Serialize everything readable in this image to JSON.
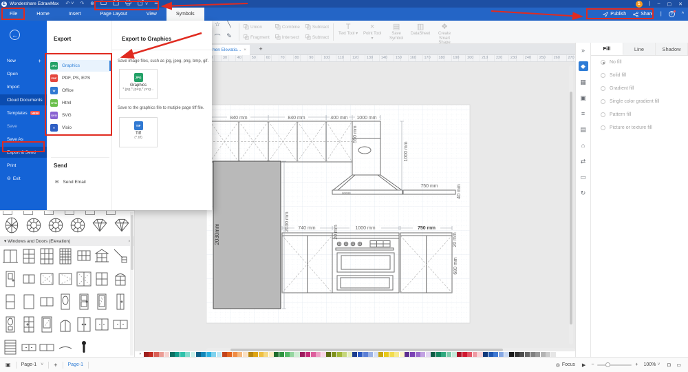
{
  "titlebar": {
    "app_title": "Wondershare EdrawMax",
    "notification_badge": "1",
    "window_buttons": {
      "minimize": "–",
      "maximize": "▢",
      "close": "✕"
    },
    "qat_icons": [
      "undo-icon",
      "redo-icon",
      "new-page-icon",
      "open-icon",
      "save-icon",
      "print-icon",
      "export-icon",
      "customize-qat-icon"
    ]
  },
  "menubar": {
    "tabs": [
      "File",
      "Home",
      "Insert",
      "Page Layout",
      "View",
      "Symbols"
    ],
    "active_tab": "Symbols",
    "publish_label": "Publish",
    "share_label": "Share",
    "collapse_icon": "^",
    "help_icon": "?"
  },
  "ribbon": {
    "shape_tools": [
      {
        "name": "star-shape-icon",
        "glyph": "☆"
      },
      {
        "name": "line-tool-icon",
        "glyph": "╲"
      },
      {
        "name": "arc-tool-icon",
        "glyph": "⌒"
      },
      {
        "name": "pen-tool-icon",
        "glyph": "✎"
      }
    ],
    "bool_ops": [
      "Union",
      "Combine",
      "Subtract",
      "Fragment",
      "Intersect",
      "Subtract"
    ],
    "tools": [
      {
        "glyph": "T",
        "label": "Text Tool ▾"
      },
      {
        "glyph": "×",
        "label": "Point Tool ▾"
      },
      {
        "glyph": "▤",
        "label": "Save Symbol"
      },
      {
        "glyph": "▥",
        "label": "DataSheet"
      },
      {
        "glyph": "❖",
        "label": "Create Smart Shape"
      }
    ]
  },
  "doc_tabs": {
    "active_label": "hen Elevatio...",
    "close": "×",
    "add": "+"
  },
  "ruler": {
    "start": 20,
    "end": 270,
    "step": 10
  },
  "file_menu": {
    "items": [
      {
        "label": "New",
        "suffix": "+"
      },
      {
        "label": "Open"
      },
      {
        "label": "Import"
      },
      {
        "label": "Cloud Documents",
        "highlighted": true
      },
      {
        "label": "Templates",
        "badge": "NEW"
      },
      {
        "label": "Save",
        "dimmed": true
      },
      {
        "label": "Save As"
      },
      {
        "label": "Export & Send",
        "highlighted": true
      },
      {
        "label": "Print"
      },
      {
        "label": "Exit",
        "prefix": "⊖"
      }
    ]
  },
  "export_panel": {
    "heading": "Export",
    "formats": [
      {
        "label": "Graphics",
        "icon_text": "JPG",
        "icon_color": "#23a167",
        "selected": true
      },
      {
        "label": "PDF, PS, EPS",
        "icon_text": "PDF",
        "icon_color": "#e5473e"
      },
      {
        "label": "Office",
        "icon_text": "W",
        "icon_color": "#3079d2"
      },
      {
        "label": "Html",
        "icon_text": "HTM",
        "icon_color": "#6abf4b"
      },
      {
        "label": "SVG",
        "icon_text": "SVG",
        "icon_color": "#8a63d2"
      },
      {
        "label": "Visio",
        "icon_text": "V",
        "icon_color": "#2f5fc4"
      }
    ],
    "send_heading": "Send",
    "send_email_label": "Send Email",
    "right": {
      "heading": "Export to Graphics",
      "desc1": "Save image files, such as jpg, jpeg, png, bmp, gif.",
      "card1": {
        "title": "Graphics",
        "sub": "*.jpg,*.jpeg,*.png...",
        "icon_text": "JPG",
        "icon_color": "#23a167"
      },
      "desc2": "Save to the graphics file to mutiple page tiff file.",
      "card2": {
        "title": "Tiff",
        "sub": "(*.tif)",
        "icon_text": "TIF",
        "icon_color": "#3079d2"
      }
    }
  },
  "drawing": {
    "dims": {
      "d840a": "840 mm",
      "d840b": "840 mm",
      "d400": "400 mm",
      "d1000hood": "1000 mm",
      "d550": "550 mm",
      "d1000r": "1000 mm",
      "d750shelf": "750 mm",
      "d40": "40 mm",
      "label2030": "2030mm",
      "d2030": "2030 mm",
      "d740": "740 mm",
      "d1000stove": "1000 mm",
      "d750base": "750 mm",
      "d20l": "20 mm",
      "d20r": "20 mm",
      "d680": "680 mm"
    }
  },
  "right_strip": {
    "icons": [
      {
        "name": "more-panels-icon",
        "glyph": "»",
        "active": false
      },
      {
        "name": "fill-tool-icon",
        "glyph": "◆",
        "active": true
      },
      {
        "name": "symbol-library-icon",
        "glyph": "▦",
        "active": false
      },
      {
        "name": "picture-icon",
        "glyph": "▣",
        "active": false
      },
      {
        "name": "layers-icon",
        "glyph": "≡",
        "active": false
      },
      {
        "name": "notes-icon",
        "glyph": "▤",
        "active": false
      },
      {
        "name": "floorplan-icon",
        "glyph": "⌂",
        "active": false
      },
      {
        "name": "swap-icon",
        "glyph": "⇄",
        "active": false
      },
      {
        "name": "presentation-icon",
        "glyph": "▭",
        "active": false
      },
      {
        "name": "history-icon",
        "glyph": "↻",
        "active": false
      }
    ]
  },
  "right_panel": {
    "tabs": [
      "Fill",
      "Line",
      "Shadow"
    ],
    "active_tab": "Fill",
    "fill_options": [
      "No fill",
      "Solid fill",
      "Gradient fill",
      "Single color gradient fill",
      "Pattern fill",
      "Picture or texture fill"
    ],
    "selected_option": "No fill"
  },
  "library": {
    "header": "Windows and Doors (Elevation)",
    "close": "×",
    "collapse_icon": "▾",
    "gems": [
      "gemoval",
      "gemround",
      "gemround",
      "gemround",
      "diamond",
      "diamond"
    ],
    "symbols": [
      "w2",
      "g6",
      "g9",
      "gd",
      "g23",
      "ped",
      "lamp",
      "door1",
      "w2s",
      "wx",
      "wv",
      "wxl",
      "w4",
      "archg",
      "w2v",
      "blank",
      "w2h",
      "ovald",
      "paneld",
      "mirrord",
      "slimd",
      "ovali",
      "panel2",
      "glassd",
      "archd",
      "dbl",
      "dblcab",
      "widecab",
      "shutter",
      "widelow",
      "widelow2",
      "awning",
      "handle"
    ]
  },
  "palette": {
    "colors": [
      "#9c1f1d",
      "#c22a20",
      "#da6056",
      "#eb9d96",
      "#f6d2cf",
      "#0e6f62",
      "#139c8a",
      "#2fc2ab",
      "#82dccd",
      "#c8f0e9",
      "#0c6086",
      "#1287ba",
      "#2cb1e0",
      "#80d2ee",
      "#c0e8f6",
      "#c2441c",
      "#e2641f",
      "#f08c44",
      "#f6b97f",
      "#fbe0c2",
      "#b8860f",
      "#dda414",
      "#efc043",
      "#f6d982",
      "#fbeec4",
      "#1e6b2d",
      "#2e9440",
      "#55b968",
      "#95d6a0",
      "#d0ecd4",
      "#9c1c5e",
      "#c42a77",
      "#dd5f9d",
      "#eea0c5",
      "#f8d5e6",
      "#5d6b14",
      "#7e911c",
      "#a3b83a",
      "#c5d67b",
      "#e5eebd",
      "#1b3d8f",
      "#2a58c0",
      "#5b7fd6",
      "#9bb2e6",
      "#d3ddf5",
      "#c8a60e",
      "#e8c81a",
      "#f2dc4e",
      "#f7ea8c",
      "#fcf5c8",
      "#5c2d8f",
      "#7b42b4",
      "#9c6ccc",
      "#c2a2e2",
      "#e4d5f3",
      "#0d5c44",
      "#15855f",
      "#2fa87e",
      "#7ccbab",
      "#c4e9da",
      "#a81126",
      "#d01830",
      "#e25666",
      "#ef9aa3",
      "#f9d3d7",
      "#123a7a",
      "#1c55b0",
      "#3f79d2",
      "#86a8e4",
      "#c8d8f3",
      "#1a1a1a",
      "#333333",
      "#4d4d4d",
      "#666666",
      "#808080",
      "#999999",
      "#b3b3b3",
      "#cccccc",
      "#e6e6e6",
      "#ffffff"
    ]
  },
  "statusbar": {
    "pages_dropdown": "Page-1",
    "add_page": "+",
    "active_page_tab": "Page-1",
    "focus_label": "Focus",
    "zoom_level": "100%"
  }
}
